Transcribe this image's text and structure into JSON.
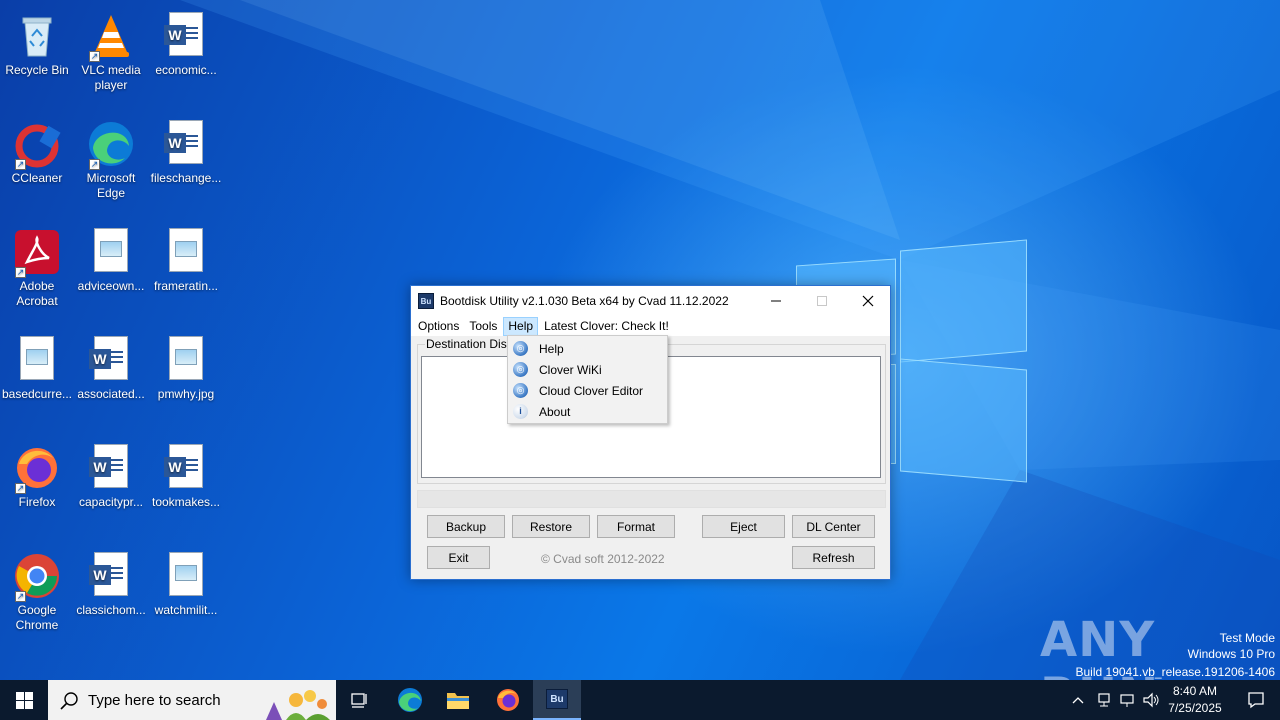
{
  "desktop": {
    "icons": [
      {
        "label": "Recycle Bin",
        "icon": "recycle-bin-icon"
      },
      {
        "label": "VLC media player",
        "icon": "vlc-icon"
      },
      {
        "label": "economic...",
        "icon": "word-doc-icon"
      },
      {
        "label": "CCleaner",
        "icon": "ccleaner-icon"
      },
      {
        "label": "Microsoft Edge",
        "icon": "edge-icon"
      },
      {
        "label": "fileschange...",
        "icon": "word-doc-icon"
      },
      {
        "label": "Adobe Acrobat",
        "icon": "acrobat-icon"
      },
      {
        "label": "adviceown...",
        "icon": "image-file-icon"
      },
      {
        "label": "frameratin...",
        "icon": "image-file-icon"
      },
      {
        "label": "basedcurre...",
        "icon": "image-file-icon"
      },
      {
        "label": "associated...",
        "icon": "word-doc-icon"
      },
      {
        "label": "pmwhy.jpg",
        "icon": "image-file-icon"
      },
      {
        "label": "Firefox",
        "icon": "firefox-icon"
      },
      {
        "label": "capacitypr...",
        "icon": "word-doc-icon"
      },
      {
        "label": "tookmakes...",
        "icon": "word-doc-icon"
      },
      {
        "label": "Google Chrome",
        "icon": "chrome-icon"
      },
      {
        "label": "classichom...",
        "icon": "word-doc-icon"
      },
      {
        "label": "watchmilit...",
        "icon": "image-file-icon"
      }
    ]
  },
  "window": {
    "app_icon_text": "Bu",
    "title": "Bootdisk Utility v2.1.030 Beta x64 by Cvad 11.12.2022",
    "menu": [
      "Options",
      "Tools",
      "Help",
      "Latest Clover: Check It!"
    ],
    "group_label": "Destination Disk",
    "buttons": {
      "backup": "Backup",
      "restore": "Restore",
      "format": "Format",
      "eject": "Eject",
      "dl_center": "DL Center",
      "exit": "Exit",
      "refresh": "Refresh"
    },
    "copyright": "© Cvad soft 2012-2022"
  },
  "help_menu": {
    "items": [
      {
        "label": "Help",
        "icon": "help-globe-icon"
      },
      {
        "label": "Clover WiKi",
        "icon": "wiki-globe-icon"
      },
      {
        "label": "Cloud Clover Editor",
        "icon": "cloud-globe-icon"
      },
      {
        "label": "About",
        "icon": "info-icon"
      }
    ]
  },
  "watermark": {
    "brand": "ANY RUN",
    "line1": "Test Mode",
    "line2": "Windows 10 Pro",
    "line3": "Build 19041.vb_release.191206-1406"
  },
  "taskbar": {
    "search_placeholder": "Type here to search",
    "active_app": "Bu",
    "time": "8:40 AM",
    "date": "7/25/2025"
  }
}
